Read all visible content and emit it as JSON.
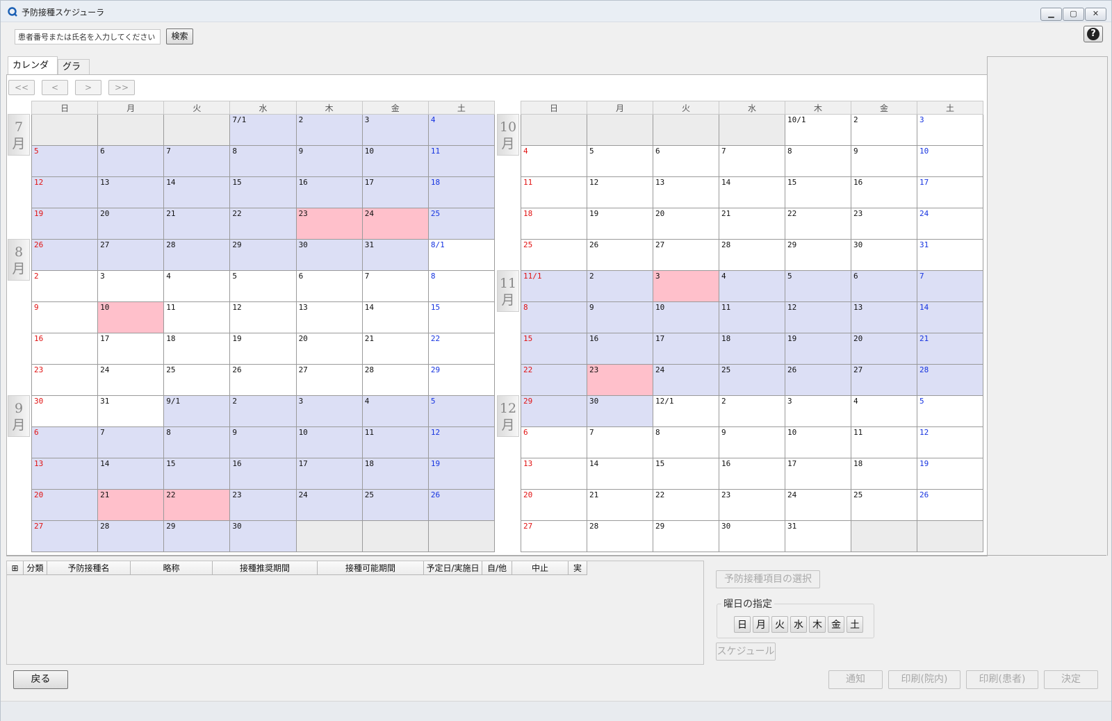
{
  "window": {
    "title": "予防接種スケジューラ",
    "controls": [
      "▁",
      "▢",
      "✕"
    ]
  },
  "search": {
    "placeholder": "患者番号または氏名を入力してください",
    "button": "検索"
  },
  "help_label": "?",
  "tabs": [
    {
      "label": "カレンダー"
    },
    {
      "label": "グラフ"
    }
  ],
  "nav": {
    "first": "<<",
    "prev": "<",
    "next": ">",
    "last": ">>"
  },
  "weekdays": [
    "日",
    "月",
    "火",
    "水",
    "木",
    "金",
    "土"
  ],
  "calendar": {
    "left": {
      "months": [
        {
          "line1": "7",
          "line2": "月"
        },
        {
          "line1": "8",
          "line2": "月"
        },
        {
          "line1": "9",
          "line2": "月"
        }
      ],
      "rows": [
        [
          "",
          "",
          "",
          "7/1",
          "2",
          "3",
          "4"
        ],
        [
          "5",
          "6",
          "7",
          "8",
          "9",
          "10",
          "11"
        ],
        [
          "12",
          "13",
          "14",
          "15",
          "16",
          "17",
          "18"
        ],
        [
          "19",
          "20",
          "21",
          "22",
          "23",
          "24",
          "25"
        ],
        [
          "26",
          "27",
          "28",
          "29",
          "30",
          "31",
          "8/1"
        ],
        [
          "2",
          "3",
          "4",
          "5",
          "6",
          "7",
          "8"
        ],
        [
          "9",
          "10",
          "11",
          "12",
          "13",
          "14",
          "15"
        ],
        [
          "16",
          "17",
          "18",
          "19",
          "20",
          "21",
          "22"
        ],
        [
          "23",
          "24",
          "25",
          "26",
          "27",
          "28",
          "29"
        ],
        [
          "30",
          "31",
          "9/1",
          "2",
          "3",
          "4",
          "5"
        ],
        [
          "6",
          "7",
          "8",
          "9",
          "10",
          "11",
          "12"
        ],
        [
          "13",
          "14",
          "15",
          "16",
          "17",
          "18",
          "19"
        ],
        [
          "20",
          "21",
          "22",
          "23",
          "24",
          "25",
          "26"
        ],
        [
          "27",
          "28",
          "29",
          "30",
          "",
          "",
          ""
        ]
      ],
      "kinds": [
        [
          "blank",
          "blank",
          "blank",
          "lav",
          "lav",
          "lav",
          "lav"
        ],
        [
          "lav",
          "lav",
          "lav",
          "lav",
          "lav",
          "lav",
          "lav"
        ],
        [
          "lav",
          "lav",
          "lav",
          "lav",
          "lav",
          "lav",
          "lav"
        ],
        [
          "lav",
          "lav",
          "lav",
          "lav",
          "pink",
          "pink",
          "lav"
        ],
        [
          "lav",
          "lav",
          "lav",
          "lav",
          "lav",
          "lav",
          "cur"
        ],
        [
          "cur",
          "cur",
          "cur",
          "cur",
          "cur",
          "cur",
          "cur"
        ],
        [
          "cur",
          "pink",
          "cur",
          "cur",
          "cur",
          "cur",
          "cur"
        ],
        [
          "cur",
          "cur",
          "cur",
          "cur",
          "cur",
          "cur",
          "cur"
        ],
        [
          "cur",
          "cur",
          "cur",
          "cur",
          "cur",
          "cur",
          "cur"
        ],
        [
          "cur",
          "cur",
          "lav",
          "lav",
          "lav",
          "lav",
          "lav"
        ],
        [
          "lav",
          "lav",
          "lav",
          "lav",
          "lav",
          "lav",
          "lav"
        ],
        [
          "lav",
          "lav",
          "lav",
          "lav",
          "lav",
          "lav",
          "lav"
        ],
        [
          "lav",
          "pink",
          "pink",
          "lav",
          "lav",
          "lav",
          "lav"
        ],
        [
          "lav",
          "lav",
          "lav",
          "lav",
          "blank",
          "blank",
          "blank"
        ]
      ]
    },
    "right": {
      "months": [
        {
          "line1": "10",
          "line2": "月"
        },
        {
          "line1": "11",
          "line2": "月"
        },
        {
          "line1": "12",
          "line2": "月"
        }
      ],
      "rows": [
        [
          "",
          "",
          "",
          "",
          "10/1",
          "2",
          "3"
        ],
        [
          "4",
          "5",
          "6",
          "7",
          "8",
          "9",
          "10"
        ],
        [
          "11",
          "12",
          "13",
          "14",
          "15",
          "16",
          "17"
        ],
        [
          "18",
          "19",
          "20",
          "21",
          "22",
          "23",
          "24"
        ],
        [
          "25",
          "26",
          "27",
          "28",
          "29",
          "30",
          "31"
        ],
        [
          "11/1",
          "2",
          "3",
          "4",
          "5",
          "6",
          "7"
        ],
        [
          "8",
          "9",
          "10",
          "11",
          "12",
          "13",
          "14"
        ],
        [
          "15",
          "16",
          "17",
          "18",
          "19",
          "20",
          "21"
        ],
        [
          "22",
          "23",
          "24",
          "25",
          "26",
          "27",
          "28"
        ],
        [
          "29",
          "30",
          "12/1",
          "2",
          "3",
          "4",
          "5"
        ],
        [
          "6",
          "7",
          "8",
          "9",
          "10",
          "11",
          "12"
        ],
        [
          "13",
          "14",
          "15",
          "16",
          "17",
          "18",
          "19"
        ],
        [
          "20",
          "21",
          "22",
          "23",
          "24",
          "25",
          "26"
        ],
        [
          "27",
          "28",
          "29",
          "30",
          "31",
          "",
          ""
        ]
      ],
      "kinds": [
        [
          "blank",
          "blank",
          "blank",
          "blank",
          "cur",
          "cur",
          "cur"
        ],
        [
          "cur",
          "cur",
          "cur",
          "cur",
          "cur",
          "cur",
          "cur"
        ],
        [
          "cur",
          "cur",
          "cur",
          "cur",
          "cur",
          "cur",
          "cur"
        ],
        [
          "cur",
          "cur",
          "cur",
          "cur",
          "cur",
          "cur",
          "cur"
        ],
        [
          "cur",
          "cur",
          "cur",
          "cur",
          "cur",
          "cur",
          "cur"
        ],
        [
          "lav",
          "lav",
          "pink",
          "lav",
          "lav",
          "lav",
          "lav"
        ],
        [
          "lav",
          "lav",
          "lav",
          "lav",
          "lav",
          "lav",
          "lav"
        ],
        [
          "lav",
          "lav",
          "lav",
          "lav",
          "lav",
          "lav",
          "lav"
        ],
        [
          "lav",
          "pink",
          "lav",
          "lav",
          "lav",
          "lav",
          "lav"
        ],
        [
          "lav",
          "lav",
          "cur",
          "cur",
          "cur",
          "cur",
          "cur"
        ],
        [
          "cur",
          "cur",
          "cur",
          "cur",
          "cur",
          "cur",
          "cur"
        ],
        [
          "cur",
          "cur",
          "cur",
          "cur",
          "cur",
          "cur",
          "cur"
        ],
        [
          "cur",
          "cur",
          "cur",
          "cur",
          "cur",
          "cur",
          "cur"
        ],
        [
          "cur",
          "cur",
          "cur",
          "cur",
          "cur",
          "blank",
          "blank"
        ]
      ]
    }
  },
  "colors": {
    "sunday": "#e11212",
    "saturday": "#1533e0",
    "range_highlight": "#dcdff5",
    "scheduled": "#ffc0cb"
  },
  "list": {
    "columns": [
      "分類",
      "予防接種名",
      "略称",
      "接種推奨期間",
      "接種可能期間",
      "予定日/実施日",
      "自/他",
      "中止",
      "実"
    ]
  },
  "controls": {
    "select_items": "予防接種項目の選択",
    "day_group_label": "曜日の指定",
    "days": [
      "日",
      "月",
      "火",
      "水",
      "木",
      "金",
      "土"
    ],
    "schedule": "スケジュール"
  },
  "footer": {
    "back": "戻る",
    "notify": "通知",
    "print_clinic": "印刷(院内)",
    "print_patient": "印刷(患者)",
    "confirm": "決定"
  }
}
